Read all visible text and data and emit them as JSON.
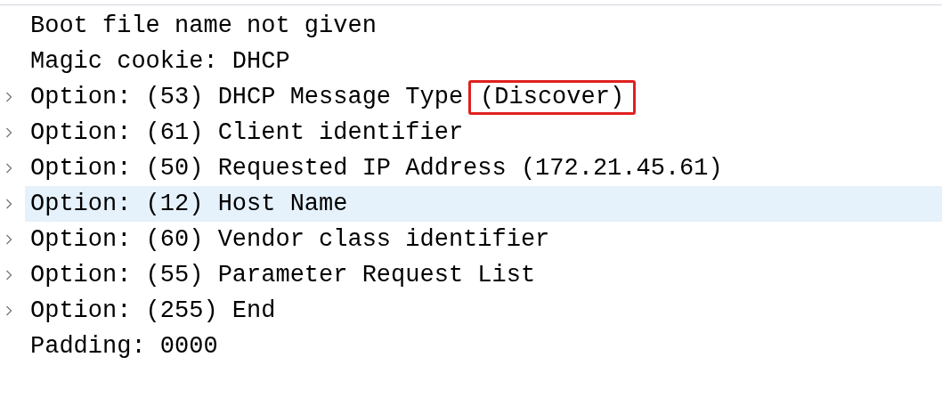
{
  "tree_rows": [
    {
      "text": "Boot file name not given",
      "expandable": false,
      "selected": false
    },
    {
      "text": "Magic cookie: DHCP",
      "expandable": false,
      "selected": false
    },
    {
      "text": "Option: (53) DHCP Message Type",
      "annotated_text": "(Discover)",
      "expandable": true,
      "selected": false
    },
    {
      "text": "Option: (61) Client identifier",
      "expandable": true,
      "selected": false
    },
    {
      "text": "Option: (50) Requested IP Address (172.21.45.61)",
      "expandable": true,
      "selected": false
    },
    {
      "text": "Option: (12) Host Name",
      "expandable": true,
      "selected": true
    },
    {
      "text": "Option: (60) Vendor class identifier",
      "expandable": true,
      "selected": false
    },
    {
      "text": "Option: (55) Parameter Request List",
      "expandable": true,
      "selected": false
    },
    {
      "text": "Option: (255) End",
      "expandable": true,
      "selected": false
    },
    {
      "text": "Padding: 0000",
      "expandable": false,
      "selected": false
    }
  ]
}
